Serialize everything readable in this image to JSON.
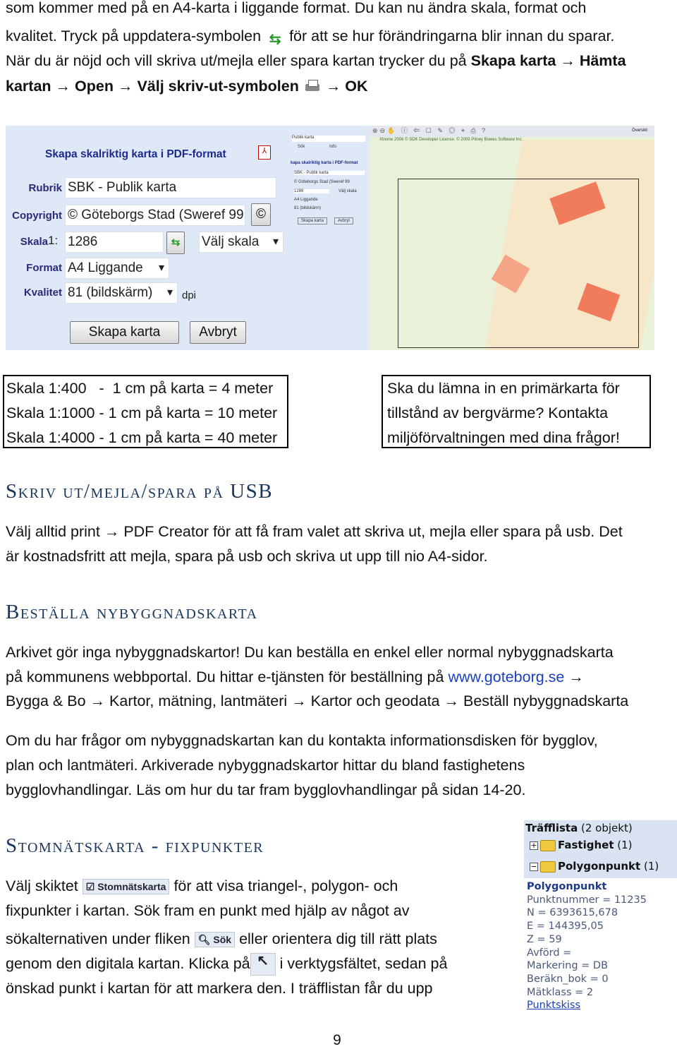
{
  "intro": {
    "l1": "som kommer med på en A4-karta i liggande format. Du kan nu ändra skala, format och",
    "l2a": "kvalitet. Tryck på uppdatera-symbolen",
    "l2b": "för att se hur förändringarna blir innan du sparar.",
    "l3a": "När du är nöjd och vill skriva ut/mejla eller spara kartan trycker du på ",
    "l3b": "Skapa karta",
    "l3c": "Hämta",
    "l4a": "kartan",
    "l4b": "Open",
    "l4c": "Välj skriv-ut-symbolen",
    "l4d": "OK",
    "arrow": "→"
  },
  "form": {
    "title": "Skapa skalriktig karta i PDF-format",
    "rubrik_label": "Rubrik",
    "rubrik_value": "SBK - Publik karta",
    "copyright_label": "Copyright",
    "copyright_value": "© Göteborgs Stad (Sweref 99",
    "copyright_btn": "©",
    "skala_label": "Skala",
    "skala_prefix": "1:",
    "skala_value": "1286",
    "skala_select": "Välj skala",
    "format_label": "Format",
    "format_value": "A4 Liggande",
    "kvalitet_label": "Kvalitet",
    "kvalitet_value": "81 (bildskärm)",
    "dpi": "dpi",
    "create_btn": "Skapa karta",
    "cancel_btn": "Avbryt"
  },
  "mini": {
    "tab_search": "Sök",
    "tab_info": "Info",
    "layer": "Publik karta",
    "title": "kapa skalriktig karta i PDF-format",
    "rubrik": "SBK - Publik karta",
    "copyright": "© Göteborgs Stad (Sweref 99",
    "skala": "1286",
    "skala_select": "Välj skala",
    "format": "A4 Liggande",
    "kvalitet": "81 (bildskärm)",
    "create": "Skapa karta",
    "cancel": "Avbryt"
  },
  "map": {
    "copyright": "Xtreme 2008 © SDK Developer License. © 2009 Pitney Bowes Software Inc.",
    "overview": "Översikt"
  },
  "scale_box": [
    "Skala 1:400   -  1 cm på karta = 4 meter",
    "Skala 1:1000 - 1 cm på karta = 10 meter",
    "Skala 1:4000 - 1 cm på karta = 40 meter"
  ],
  "notice_box": [
    "Ska du lämna in en primärkarta för",
    "tillstånd av bergvärme? Kontakta",
    "miljöförvaltningen med dina frågor!"
  ],
  "sec1": {
    "heading": "Skriv ut/mejla/spara på USB",
    "l1a": "Välj alltid print",
    "l1b": "PDF Creator för att få fram valet att skriva ut, mejla eller spara på usb. Det",
    "l2": "är kostnadsfritt att mejla, spara på usb och skriva ut upp till nio A4-sidor."
  },
  "sec2": {
    "heading": "Beställa nybyggnadskarta",
    "l1": "Arkivet gör inga nybyggnadskartor! Du kan beställa en enkel eller normal nybyggnadskarta",
    "l2a": "på kommunens webbportal. Du hittar e-tjänsten för beställning på ",
    "link": "www.goteborg.se",
    "l3": [
      "Bygga & Bo",
      "Kartor, mätning, lantmäteri",
      "Kartor och geodata",
      "Beställ nybyggnadskarta"
    ],
    "p2": [
      "Om du har frågor om nybyggnadskartan kan du kontakta informationsdisken för bygglov,",
      "plan och lantmäteri. Arkiverade nybyggnadskartor hittar du bland fastighetens",
      "bygglovhandlingar. Läs om hur du tar fram bygglovhandlingar på sidan 14-20."
    ]
  },
  "sec3": {
    "heading": "Stomnätskarta - fixpunkter",
    "l1a": "Välj skiktet",
    "layer_chip": "Stomnätskarta",
    "l1b": "för att visa triangel-, polygon- och",
    "l2": "fixpunkter i kartan. Sök fram en punkt med hjälp av något av",
    "l3a": "sökalternativen under fliken",
    "search_chip": "Sök",
    "l3b": "eller orientera dig till rätt plats",
    "l4a": "genom den digitala kartan. Klicka på",
    "l4b": "i verktygsfältet, sedan på",
    "l5": "önskad punkt i kartan för att markera den. I träfflistan får du upp"
  },
  "hits": {
    "title": "Träfflista",
    "count": "(2 objekt)",
    "groups": [
      {
        "name": "Fastighet",
        "count": "(1)",
        "sign": "+"
      },
      {
        "name": "Polygonpunkt",
        "count": "(1)",
        "sign": "−"
      }
    ],
    "detail_title": "Polygonpunkt",
    "details": [
      "Punktnummer = 11235",
      "N = 6393615,678",
      "E = 144395,05",
      "Z = 59",
      "Avförd =",
      "Markering = DB",
      "Beräkn_bok = 0",
      "Mätklass = 2"
    ],
    "link": "Punktskiss"
  },
  "page_number": "9"
}
